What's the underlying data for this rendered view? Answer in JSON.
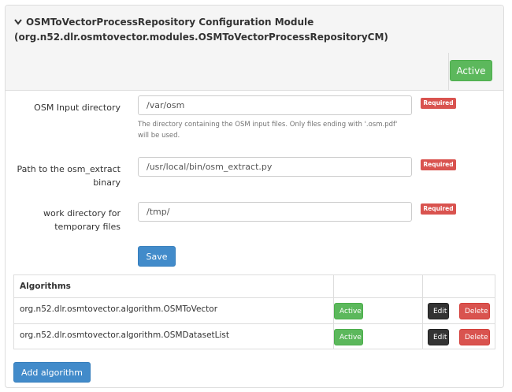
{
  "module": {
    "title_line1": "OSMToVectorProcessRepository Configuration Module",
    "title_line2": "(org.n52.dlr.osmtovector.modules.OSMToVectorProcessRepositoryCM)",
    "status_label": "Active",
    "caret_icon": "chevron-down-icon"
  },
  "form": {
    "fields": [
      {
        "label": "OSM Input directory",
        "value": "/var/osm",
        "badge": "Required",
        "help": "The directory containing the OSM input files. Only files ending with '.osm.pdf' will be used."
      },
      {
        "label": "Path to the osm_extract binary",
        "value": "/usr/local/bin/osm_extract.py",
        "badge": "Required"
      },
      {
        "label": "work directory for temporary files",
        "value": "/tmp/",
        "badge": "Required"
      }
    ],
    "save_label": "Save"
  },
  "algorithms": {
    "header": "Algorithms",
    "rows": [
      {
        "name": "org.n52.dlr.osmtovector.algorithm.OSMToVector",
        "status": "Active",
        "edit": "Edit",
        "delete": "Delete"
      },
      {
        "name": "org.n52.dlr.osmtovector.algorithm.OSMDatasetList",
        "status": "Active",
        "edit": "Edit",
        "delete": "Delete"
      }
    ],
    "add_label": "Add algorithm"
  },
  "colors": {
    "success": "#5cb85c",
    "primary": "#428bca",
    "danger": "#d9534f",
    "dark": "#333333"
  }
}
